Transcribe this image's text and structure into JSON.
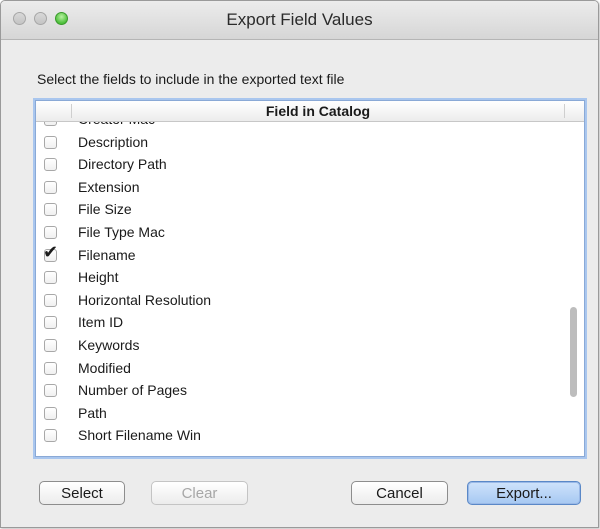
{
  "window": {
    "title": "Export Field Values"
  },
  "instruction": "Select the fields to include in the exported text file",
  "list": {
    "header": "Field in Catalog",
    "rows": [
      {
        "label": "Creator Mac",
        "checked": false
      },
      {
        "label": "Description",
        "checked": false
      },
      {
        "label": "Directory Path",
        "checked": false
      },
      {
        "label": "Extension",
        "checked": false
      },
      {
        "label": "File Size",
        "checked": false
      },
      {
        "label": "File Type Mac",
        "checked": false
      },
      {
        "label": "Filename",
        "checked": true
      },
      {
        "label": "Height",
        "checked": false
      },
      {
        "label": "Horizontal Resolution",
        "checked": false
      },
      {
        "label": "Item ID",
        "checked": false
      },
      {
        "label": "Keywords",
        "checked": false
      },
      {
        "label": "Modified",
        "checked": false
      },
      {
        "label": "Number of Pages",
        "checked": false
      },
      {
        "label": "Path",
        "checked": false
      },
      {
        "label": "Short Filename Win",
        "checked": false
      }
    ]
  },
  "buttons": {
    "select": "Select",
    "clear": "Clear",
    "cancel": "Cancel",
    "export": "Export..."
  },
  "colors": {
    "window_bg": "#ececec",
    "focus_ring": "#a9c6ee",
    "default_button": "#a6c8f2",
    "zoom_button": "#4dbf3b"
  }
}
